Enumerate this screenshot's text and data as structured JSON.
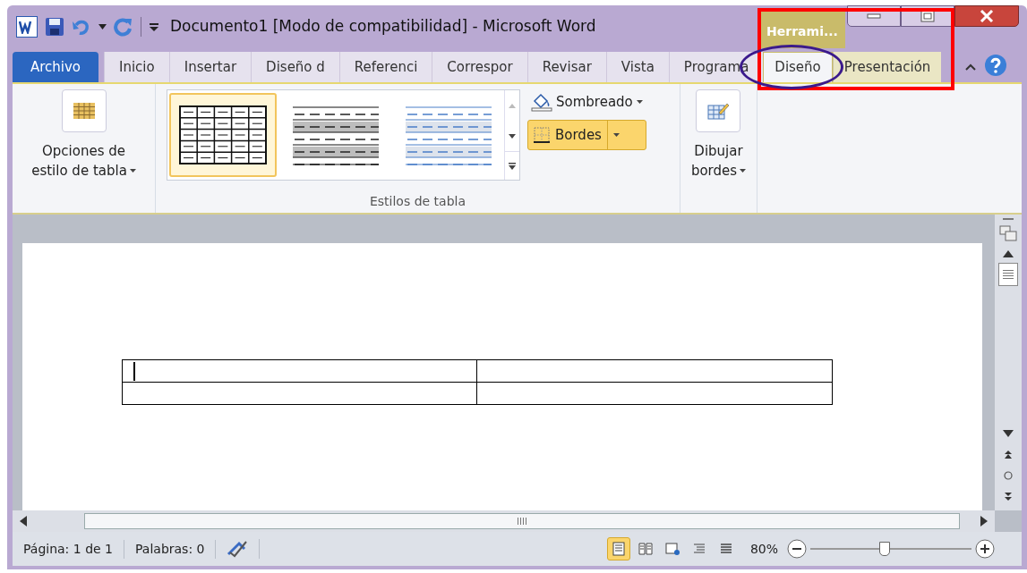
{
  "window": {
    "title": "Documento1 [Modo de compatibilidad]  -  Microsoft Word",
    "contextual_tab": "Herrami..."
  },
  "tabs": [
    {
      "label": "Archivo",
      "kind": "file",
      "selected": false
    },
    {
      "label": "Inicio",
      "kind": "tab",
      "selected": false
    },
    {
      "label": "Insertar",
      "kind": "tab",
      "selected": false
    },
    {
      "label": "Diseño d",
      "kind": "tab",
      "selected": false
    },
    {
      "label": "Referenci",
      "kind": "tab",
      "selected": false
    },
    {
      "label": "Correspor",
      "kind": "tab",
      "selected": false
    },
    {
      "label": "Revisar",
      "kind": "tab",
      "selected": false
    },
    {
      "label": "Vista",
      "kind": "tab",
      "selected": false
    },
    {
      "label": "Programa",
      "kind": "tab",
      "selected": false
    },
    {
      "label": "Diseño",
      "kind": "contextual",
      "selected": true
    },
    {
      "label": "Presentación",
      "kind": "contextual",
      "selected": false
    }
  ],
  "ribbon": {
    "style_options": {
      "label_line1": "Opciones de",
      "label_line2": "estilo de tabla"
    },
    "gallery": [
      {
        "kind": "grid",
        "selected": true
      },
      {
        "kind": "shaded",
        "selected": false
      },
      {
        "kind": "blue",
        "selected": false
      }
    ],
    "shading": {
      "label": "Sombreado",
      "highlighted": false
    },
    "borders": {
      "label": "Bordes",
      "highlighted": true
    },
    "group_label": "Estilos de tabla",
    "draw_borders": {
      "label_line1": "Dibujar",
      "label_line2": "bordes"
    }
  },
  "status_bar": {
    "page": "Página: 1 de 1",
    "words": "Palabras: 0",
    "views": [
      {
        "selected": true
      },
      {
        "selected": false
      },
      {
        "selected": false
      },
      {
        "selected": false
      },
      {
        "selected": false
      }
    ],
    "zoom": "80%",
    "zoom_level": {
      "level": 0.46
    }
  }
}
